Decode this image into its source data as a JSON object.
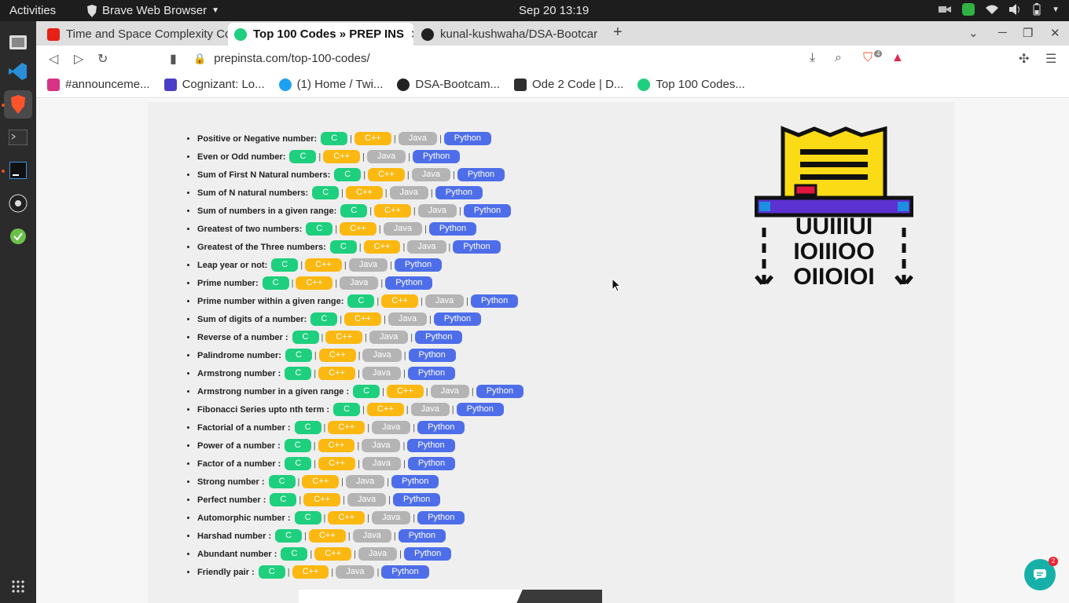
{
  "system": {
    "activities": "Activities",
    "app_name": "Brave Web Browser",
    "clock": "Sep 20  13:19"
  },
  "tabs": [
    {
      "label": "Time and Space Complexity Cc",
      "icon_color": "#e62117"
    },
    {
      "label": "Top 100 Codes » PREP INS",
      "icon_color": "#1ecf7e",
      "active": true
    },
    {
      "label": "kunal-kushwaha/DSA-Bootcar",
      "icon_color": "#222222"
    }
  ],
  "url": "prepinsta.com/top-100-codes/",
  "shield_count": "4",
  "bookmarks": [
    {
      "label": "#announceme...",
      "icon_color": "#d63384"
    },
    {
      "label": "Cognizant: Lo...",
      "icon_color": "#4b3ec6"
    },
    {
      "label": "(1) Home / Twi...",
      "icon_color": "#1da1f2"
    },
    {
      "label": "DSA-Bootcam...",
      "icon_color": "#222222"
    },
    {
      "label": "Ode 2 Code | D...",
      "icon_color": "#2f2f2f"
    },
    {
      "label": "Top 100 Codes...",
      "icon_color": "#1ecf7e"
    }
  ],
  "languages": {
    "c": "C",
    "cpp": "C++",
    "java": "Java",
    "python": "Python"
  },
  "programs": [
    "Positive or Negative number:",
    "Even or Odd number:",
    "Sum of First N Natural numbers:",
    "Sum of N natural numbers:",
    "Sum of numbers in a given range:",
    "Greatest of two numbers:",
    "Greatest of the Three numbers:",
    "Leap year or not:",
    "Prime number:",
    "Prime number within a given range:",
    "Sum of digits of a number:",
    "Reverse of a number :",
    "Palindrome number:",
    "Armstrong number :",
    "Armstrong number in a given range :",
    "Fibonacci Series upto nth term :",
    "Factorial of a number :",
    "Power of a number :",
    "Factor of a number :",
    "Strong number :",
    "Perfect number :",
    "Automorphic number :",
    "Harshad number :",
    "Abundant number :",
    "Friendly pair :"
  ],
  "illustration_bits": [
    "UUIIIUI",
    "IOIIIOO",
    "OIIOIOI"
  ],
  "chat_badge": "2"
}
